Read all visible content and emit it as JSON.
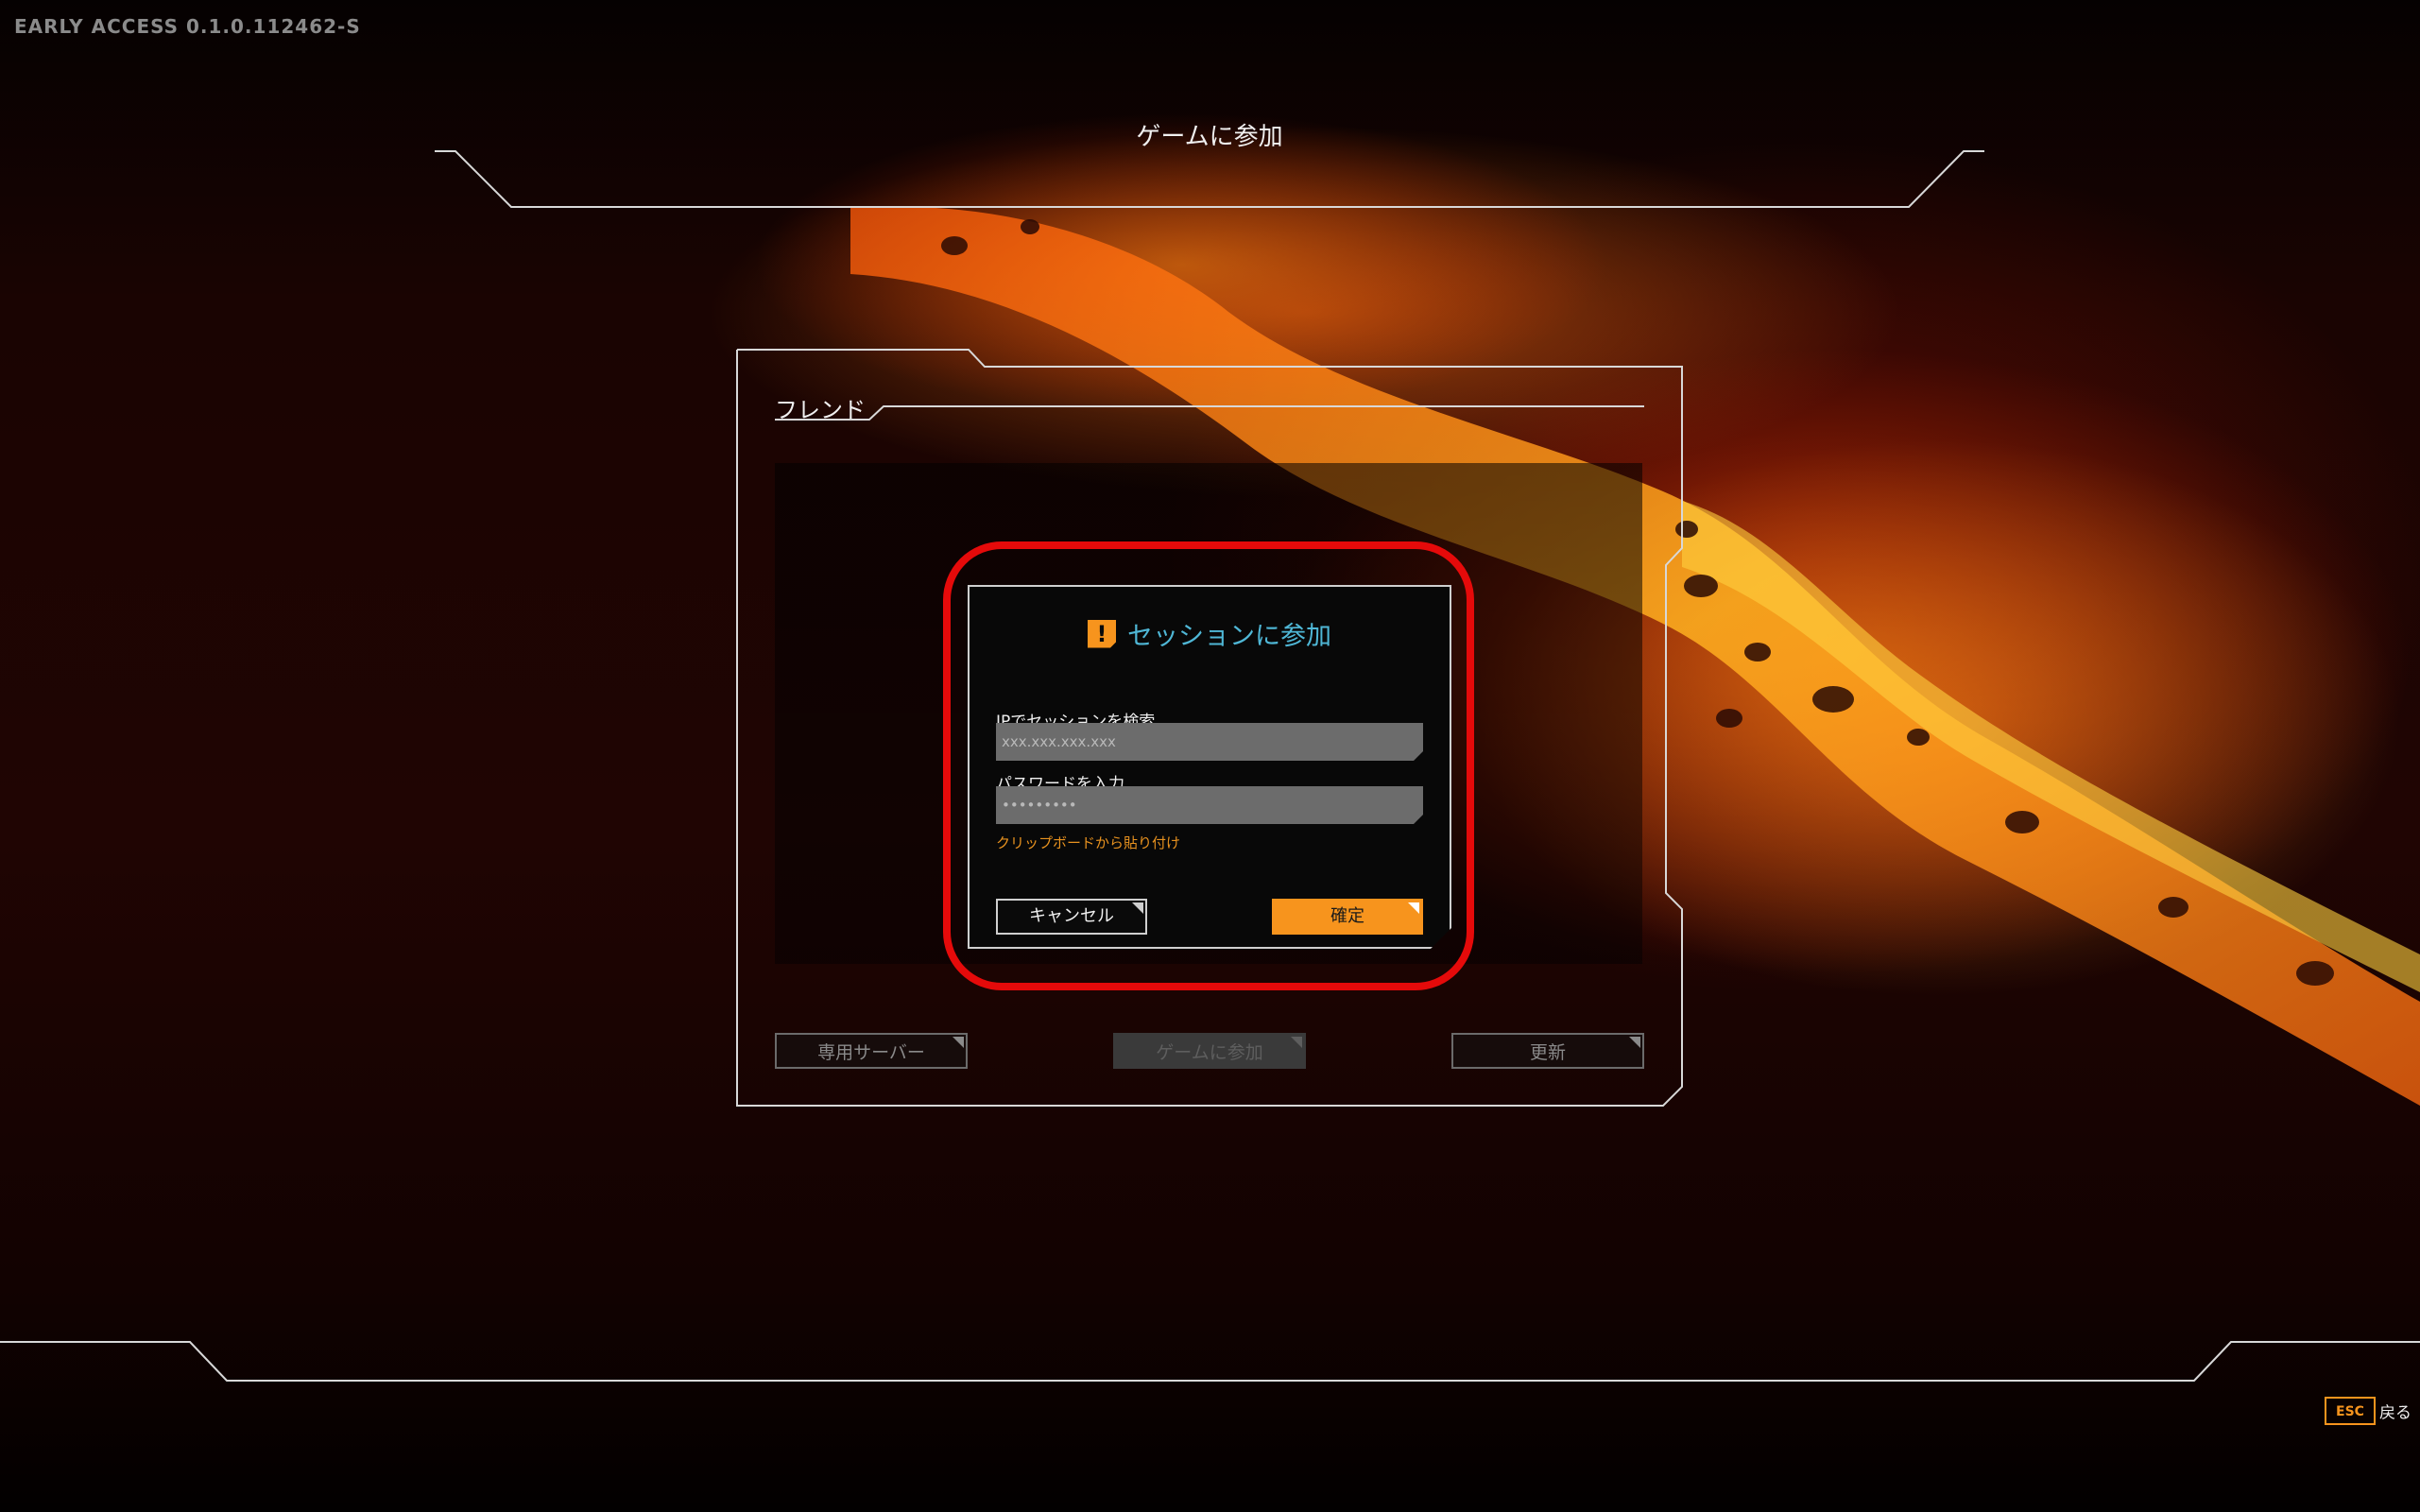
{
  "app": {
    "version": "EARLY ACCESS 0.1.0.112462-S",
    "page_title": "ゲームに参加"
  },
  "friend_panel": {
    "tab_label": "フレンド",
    "footer_buttons": [
      {
        "label": "専用サーバー",
        "enabled": true
      },
      {
        "label": "ゲームに参加",
        "enabled": false
      },
      {
        "label": "更新",
        "enabled": true
      }
    ]
  },
  "dialog": {
    "title": "セッションに参加",
    "icon": "alert-icon",
    "ip_label": "IPでセッションを検索",
    "ip_value": "xxx.xxx.xxx.xxx",
    "password_label": "パスワードを入力",
    "password_value": "•••••••••",
    "paste_link": "クリップボードから貼り付け",
    "cancel_label": "キャンセル",
    "confirm_label": "確定"
  },
  "footer": {
    "esc_key": "ESC",
    "esc_label": "戻る"
  },
  "colors": {
    "accent": "#f7941d",
    "dialog_title": "#4fb7d6",
    "highlight": "#e50a0a"
  }
}
